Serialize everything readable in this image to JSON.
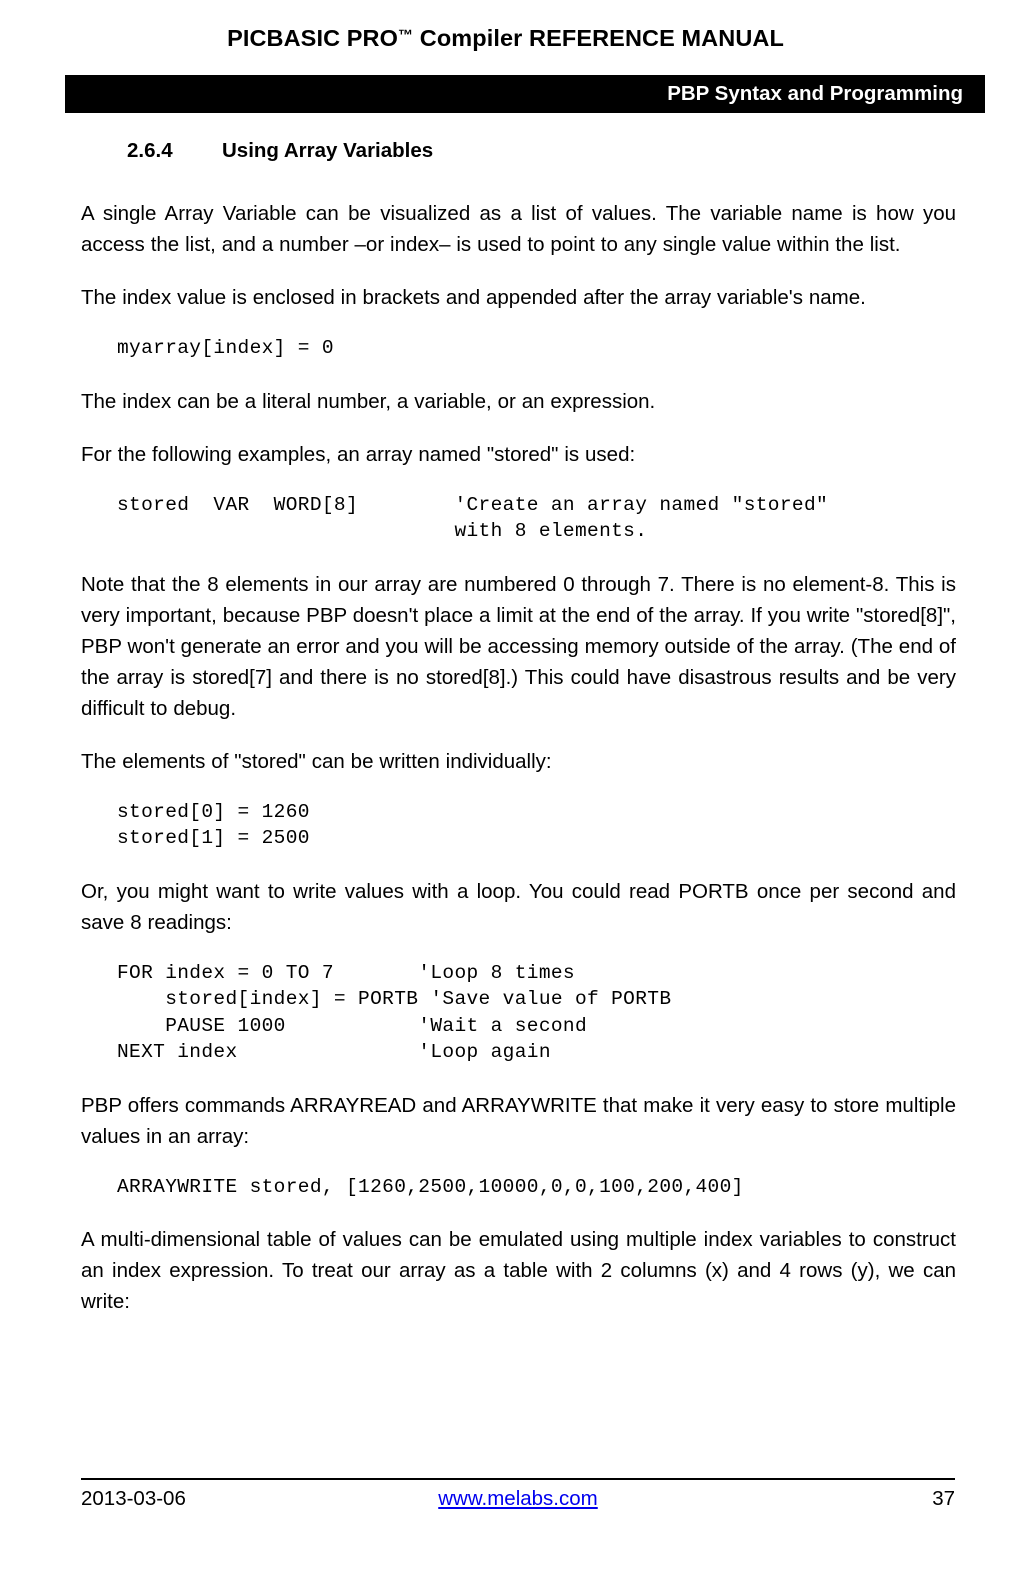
{
  "header": {
    "doc_title_pre": "PICBASIC PRO",
    "doc_title_tm": "™",
    "doc_title_post": " Compiler REFERENCE MANUAL",
    "bar_text": "PBP Syntax and Programming"
  },
  "section": {
    "number": "2.6.4",
    "title": "Using Array Variables"
  },
  "body": {
    "p1": "A single Array Variable can be visualized as a list of values.  The variable name is how you access the list, and a number –or index– is used to point to any single value within the list.",
    "p2": "The index value is enclosed in brackets and appended after the array variable's name.",
    "code1": "myarray[index] = 0",
    "p3": "The index can be a literal number, a variable, or an expression.",
    "p4": "For the following examples, an array named \"stored\" is used:",
    "code2": "stored  VAR  WORD[8]        'Create an array named \"stored\"\n                            with 8 elements.",
    "p5": "Note that the 8 elements in our array are numbered 0 through 7.  There is no element-8.  This is very important, because PBP doesn't place a limit at the end of the array.  If you write \"stored[8]\", PBP won't generate an error and you will be accessing memory outside of the array.  (The end of the array is stored[7] and there is no stored[8].)  This could have disastrous results and be very difficult to debug.",
    "p6": "The elements of \"stored\" can be written individually:",
    "code3": "stored[0] = 1260\nstored[1] = 2500",
    "p7": "Or, you might want to write values with a loop.  You could read PORTB once per second and save 8 readings:",
    "code4": "FOR index = 0 TO 7       'Loop 8 times\n    stored[index] = PORTB 'Save value of PORTB\n    PAUSE 1000           'Wait a second\nNEXT index               'Loop again",
    "p8": "PBP offers commands ARRAYREAD and ARRAYWRITE that make it very easy to store multiple values in an array:",
    "code5": "ARRAYWRITE stored, [1260,2500,10000,0,0,100,200,400]",
    "p9": "A multi-dimensional table of values can be emulated using multiple index variables to construct an index expression.  To treat our array as a table with 2 columns (x) and 4 rows (y), we can write:"
  },
  "footer": {
    "date": "2013-03-06",
    "link": "www.melabs.com",
    "page_number": "37"
  },
  "colors": {
    "bar_background": "#000000",
    "bar_text": "#ffffff",
    "link": "#0000ee",
    "text": "#000000",
    "page_background": "#ffffff"
  }
}
